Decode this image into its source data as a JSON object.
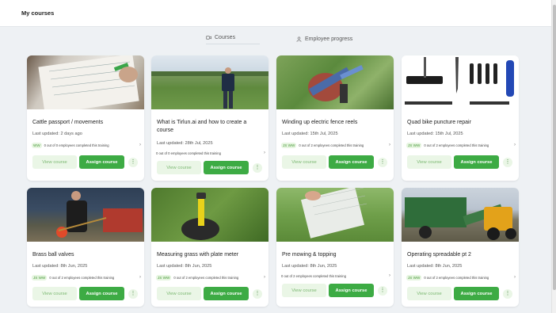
{
  "header": {
    "title": "My courses"
  },
  "tabs": [
    {
      "label": "Courses",
      "icon": "video-icon"
    },
    {
      "label": "Employee progress",
      "icon": "user-icon"
    }
  ],
  "buttons": {
    "view": "View course",
    "assign": "Assign course",
    "more": "⋮"
  },
  "colors": {
    "accent": "#3dab44",
    "accent_light": "#eaf6e6",
    "background": "#eef1f4"
  },
  "courses": [
    {
      "title": "Cattle passport / movements",
      "updated": "Last updated: 2 days ago",
      "badge": "WW",
      "completion": "0 out of 0 employees completed this training"
    },
    {
      "title": "What is Tirlun.ai and how to create a course",
      "updated": "Last updated: 28th Jul, 2025",
      "badge": "",
      "completion": "0 out of 0 employees completed this training"
    },
    {
      "title": "Winding up electric fence reels",
      "updated": "Last updated: 15th Jul, 2025",
      "badge": "JS WW",
      "completion": "0 out of 2 employees completed this training"
    },
    {
      "title": "Quad bike puncture repair",
      "updated": "Last updated: 15th Jul, 2025",
      "badge": "JS WW",
      "completion": "0 out of 2 employees completed this training"
    },
    {
      "title": "Brass ball valves",
      "updated": "Last updated: 8th Jun, 2025",
      "badge": "JS WW",
      "completion": "0 out of 2 employees completed this training"
    },
    {
      "title": "Measuring grass with plate meter",
      "updated": "Last updated: 8th Jun, 2025",
      "badge": "JS WW",
      "completion": "0 out of 2 employees completed this training"
    },
    {
      "title": "Pre mowing & topping",
      "updated": "Last updated: 8th Jun, 2025",
      "badge": "",
      "completion": "0 out of 2 employees completed this training"
    },
    {
      "title": "Operating spreadable pt 2",
      "updated": "Last updated: 8th Jun, 2025",
      "badge": "JS WW",
      "completion": "0 out of 2 employees completed this training"
    }
  ]
}
